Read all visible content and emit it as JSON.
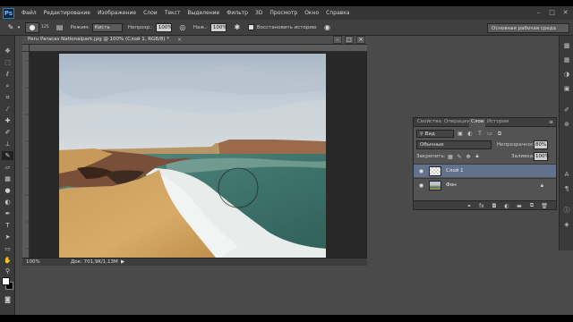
{
  "app": {
    "logo_text": "Ps",
    "menu": [
      "Файл",
      "Редактирование",
      "Изображение",
      "Слои",
      "Текст",
      "Выделение",
      "Фильтр",
      "3D",
      "Просмотр",
      "Окно",
      "Справка"
    ],
    "window_controls": {
      "minimize": "–",
      "maximize": "□",
      "close": "✕"
    }
  },
  "options_bar": {
    "brush_size": "125",
    "mode_label": "Режим:",
    "mode_value": "Кисть",
    "opacity_label": "Непрозр.:",
    "opacity_value": "100%",
    "pressure_label": "Наж.:",
    "pressure_value": "100%",
    "history_label": "Восстановить историю",
    "workspace": "Основная рабочая среда"
  },
  "document": {
    "tab_title": "Peru Paracas Nationalpark.jpg @ 100% (Слой 1, RGB/8) *",
    "close_glyph": "×",
    "zoom": "100%",
    "doc_info": "Док: 701,9K/1,13M",
    "status_arrow": "▶",
    "brush_cursor_visible": true
  },
  "layers_panel": {
    "tabs": [
      "Свойства",
      "Операции",
      "Слои",
      "История"
    ],
    "active_tab": "Слои",
    "menu_glyph": "≡",
    "filter_label": "Вид",
    "blend_mode": "Обычные",
    "opacity_label": "Непрозрачность:",
    "opacity_value": "80%",
    "lock_label": "Закрепить:",
    "fill_label": "Заливка:",
    "fill_value": "100%",
    "layers": [
      {
        "name": "Слой 1",
        "visible": true,
        "selected": true,
        "thumb": "transparent"
      },
      {
        "name": "Фон",
        "visible": true,
        "selected": false,
        "thumb": "photo",
        "locked": true
      }
    ]
  },
  "colors": {
    "foreground": "#ffffff",
    "background": "#000000",
    "selected_layer": "#62728c",
    "ui_dark": "#353535"
  }
}
